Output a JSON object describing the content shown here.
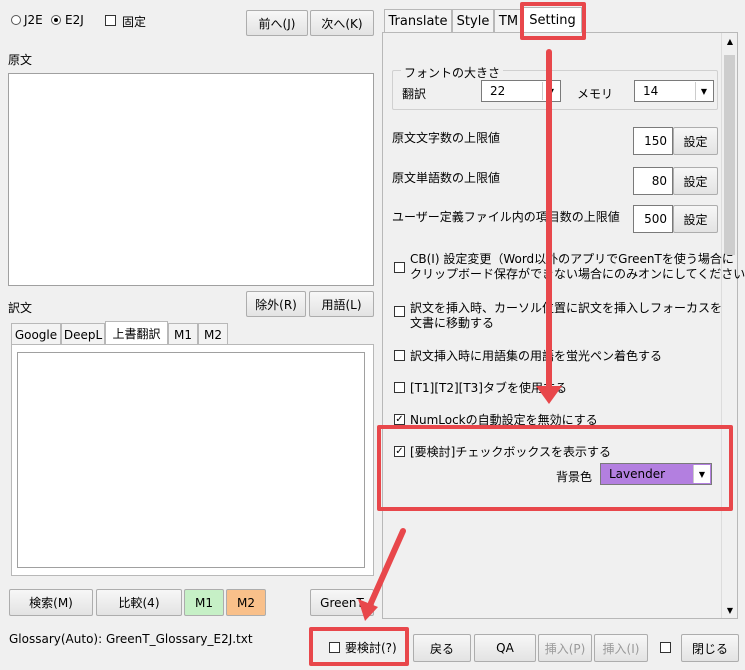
{
  "direction": {
    "option_j2e": "J2E",
    "option_e2j": "E2J",
    "selected": "E2J",
    "fixed_label": "固定"
  },
  "nav": {
    "prev": "前へ(J)",
    "next": "次へ(K)"
  },
  "source": {
    "label": "原文"
  },
  "translation": {
    "label": "訳文",
    "exclude_button": "除外(R)",
    "terms_button": "用語(L)",
    "tabs": [
      "Google",
      "DeepL",
      "上書翻訳",
      "M1",
      "M2"
    ],
    "active_tab": "上書翻訳"
  },
  "left_bottom": {
    "search": "検索(M)",
    "compare": "比較(4)",
    "m1": "M1",
    "m2": "M2",
    "greent": "GreenT"
  },
  "right_tabs": {
    "items": [
      "Translate",
      "Style",
      "TM",
      "Setting"
    ],
    "active": "Setting"
  },
  "settings": {
    "font_group": {
      "title": "フォントの大きさ",
      "translation_label": "翻訳",
      "translation_value": "22",
      "memory_label": "メモリ",
      "memory_value": "14"
    },
    "limits": [
      {
        "label": "原文文字数の上限値",
        "value": "150",
        "button": "設定"
      },
      {
        "label": "原文単語数の上限値",
        "value": "80",
        "button": "設定"
      },
      {
        "label": "ユーザー定義ファイル内の項目数の上限値",
        "value": "500",
        "button": "設定"
      }
    ],
    "options": [
      {
        "text": "CB(I) 設定変更（Word以外のアプリでGreenTを使う場合に\nクリップボード保存ができない場合にのみオンにしてください。）",
        "checked": false
      },
      {
        "text": "訳文を挿入時、カーソル位置に訳文を挿入しフォーカスを\n文書に移動する",
        "checked": false
      },
      {
        "text": "訳文挿入時に用語集の用語を蛍光ペン着色する",
        "checked": false
      },
      {
        "text": "[T1][T2][T3]タブを使用する",
        "checked": false
      },
      {
        "text": "NumLockの自動設定を無効にする",
        "checked": true
      },
      {
        "text": "[要検討]チェックボックスを表示する",
        "checked": true
      }
    ],
    "bg_color_label": "背景色",
    "bg_color_value": "Lavender",
    "bg_color_hex": "#b37fe0"
  },
  "status_bar": {
    "glossary": "Glossary(Auto): GreenT_Glossary_E2J.txt",
    "review_label": "要検討(?)",
    "back": "戻る",
    "qa": "QA",
    "insert_p": "挿入(P)",
    "insert_i": "挿入(I)",
    "close": "閉じる"
  },
  "colors": {
    "highlight_red": "#e8474b",
    "m1_green": "#c6f0c6",
    "m2_orange": "#f9c08a"
  }
}
